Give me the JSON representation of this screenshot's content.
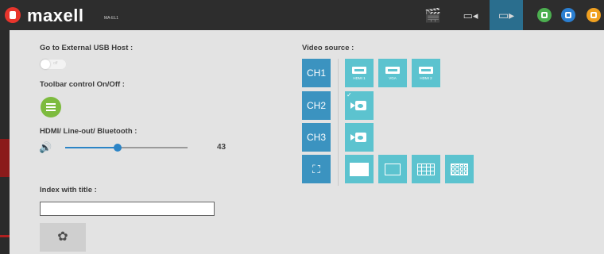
{
  "header": {
    "brand": "maxell",
    "model": "MA-EL1",
    "nav": [
      {
        "name": "clapperboard-icon",
        "glyph": "🎬",
        "active": false
      },
      {
        "name": "camera-icon",
        "glyph": "▭◃",
        "active": false
      },
      {
        "name": "monitor-icon",
        "glyph": "🖵",
        "active": true
      }
    ],
    "status_icons": [
      {
        "name": "camera-status-icon",
        "color": "#4caf50"
      },
      {
        "name": "display-status-icon",
        "color": "#2b7fd1"
      },
      {
        "name": "exit-icon",
        "color": "#f0a020"
      }
    ]
  },
  "left": {
    "usb_label": "Go to External USB Host :",
    "toggle_state": "off",
    "toolbar_label": "Toolbar control On/Off :",
    "audio_label": "HDMI/ Line-out/ Bluetooth :",
    "volume": 43,
    "volume_max": 100,
    "index_label": "Index with title :",
    "index_value": ""
  },
  "video": {
    "label": "Video source :",
    "channels": [
      "CH1",
      "CH2",
      "CH3"
    ],
    "inputs": [
      "HDMI 1",
      "VGA",
      "HDMI 2"
    ]
  },
  "colors": {
    "accent": "#3b93c0",
    "source": "#5cc3cf",
    "toolbar_button": "#7dbb3e",
    "slider": "#2b84c6"
  }
}
